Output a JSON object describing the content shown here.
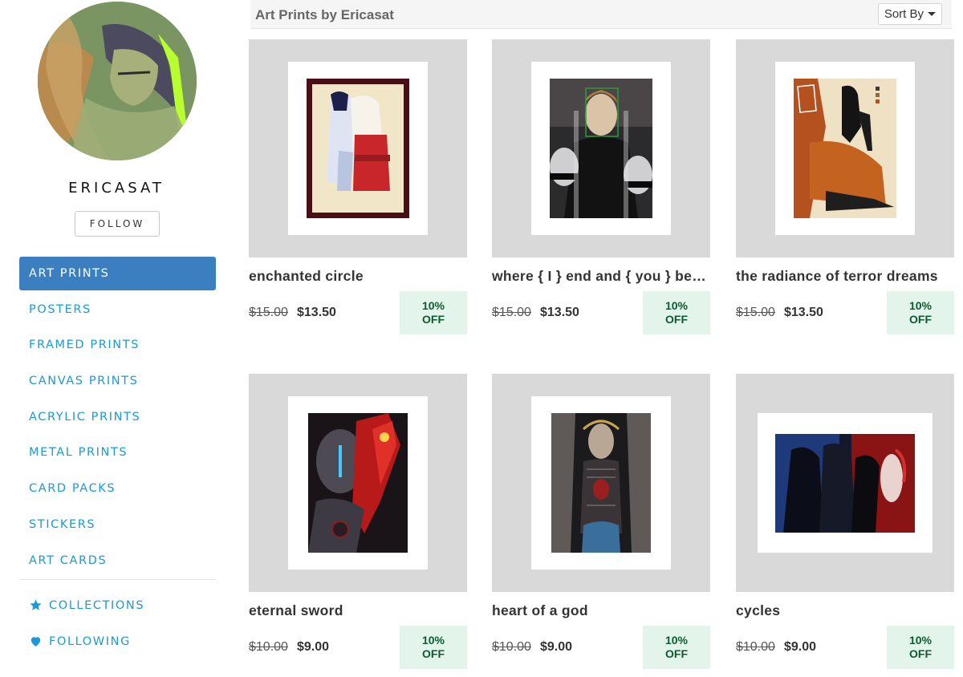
{
  "profile": {
    "username": "ERICASAT",
    "follow_label": "FOLLOW"
  },
  "nav": {
    "items": [
      {
        "label": "ART PRINTS",
        "active": true
      },
      {
        "label": "POSTERS",
        "active": false
      },
      {
        "label": "FRAMED PRINTS",
        "active": false
      },
      {
        "label": "CANVAS PRINTS",
        "active": false
      },
      {
        "label": "ACRYLIC PRINTS",
        "active": false
      },
      {
        "label": "METAL PRINTS",
        "active": false
      },
      {
        "label": "CARD PACKS",
        "active": false
      },
      {
        "label": "STICKERS",
        "active": false
      },
      {
        "label": "ART CARDS",
        "active": false
      }
    ],
    "collections_label": "COLLECTIONS",
    "following_label": "FOLLOWING"
  },
  "header": {
    "title": "Art Prints by Ericasat",
    "sort_label": "Sort By"
  },
  "products": [
    {
      "title": "enchanted circle",
      "old_price": "$15.00",
      "new_price": "$13.50",
      "badge_line1": "10%",
      "badge_line2": "OFF"
    },
    {
      "title": "where { I } end and { you } begin",
      "old_price": "$15.00",
      "new_price": "$13.50",
      "badge_line1": "10%",
      "badge_line2": "OFF"
    },
    {
      "title": "the radiance of terror dreams",
      "old_price": "$15.00",
      "new_price": "$13.50",
      "badge_line1": "10%",
      "badge_line2": "OFF"
    },
    {
      "title": "eternal sword",
      "old_price": "$10.00",
      "new_price": "$9.00",
      "badge_line1": "10%",
      "badge_line2": "OFF"
    },
    {
      "title": "heart of a god",
      "old_price": "$10.00",
      "new_price": "$9.00",
      "badge_line1": "10%",
      "badge_line2": "OFF"
    },
    {
      "title": "cycles",
      "old_price": "$10.00",
      "new_price": "$9.00",
      "badge_line1": "10%",
      "badge_line2": "OFF"
    }
  ],
  "colors": {
    "accent": "#3b7fc1",
    "link": "#1a9ad6",
    "badge_bg": "#e3f4ea",
    "badge_text": "#0c5b2f"
  },
  "icons": {
    "collections": "star-icon",
    "following": "heart-icon",
    "sort": "caret-down-icon"
  }
}
